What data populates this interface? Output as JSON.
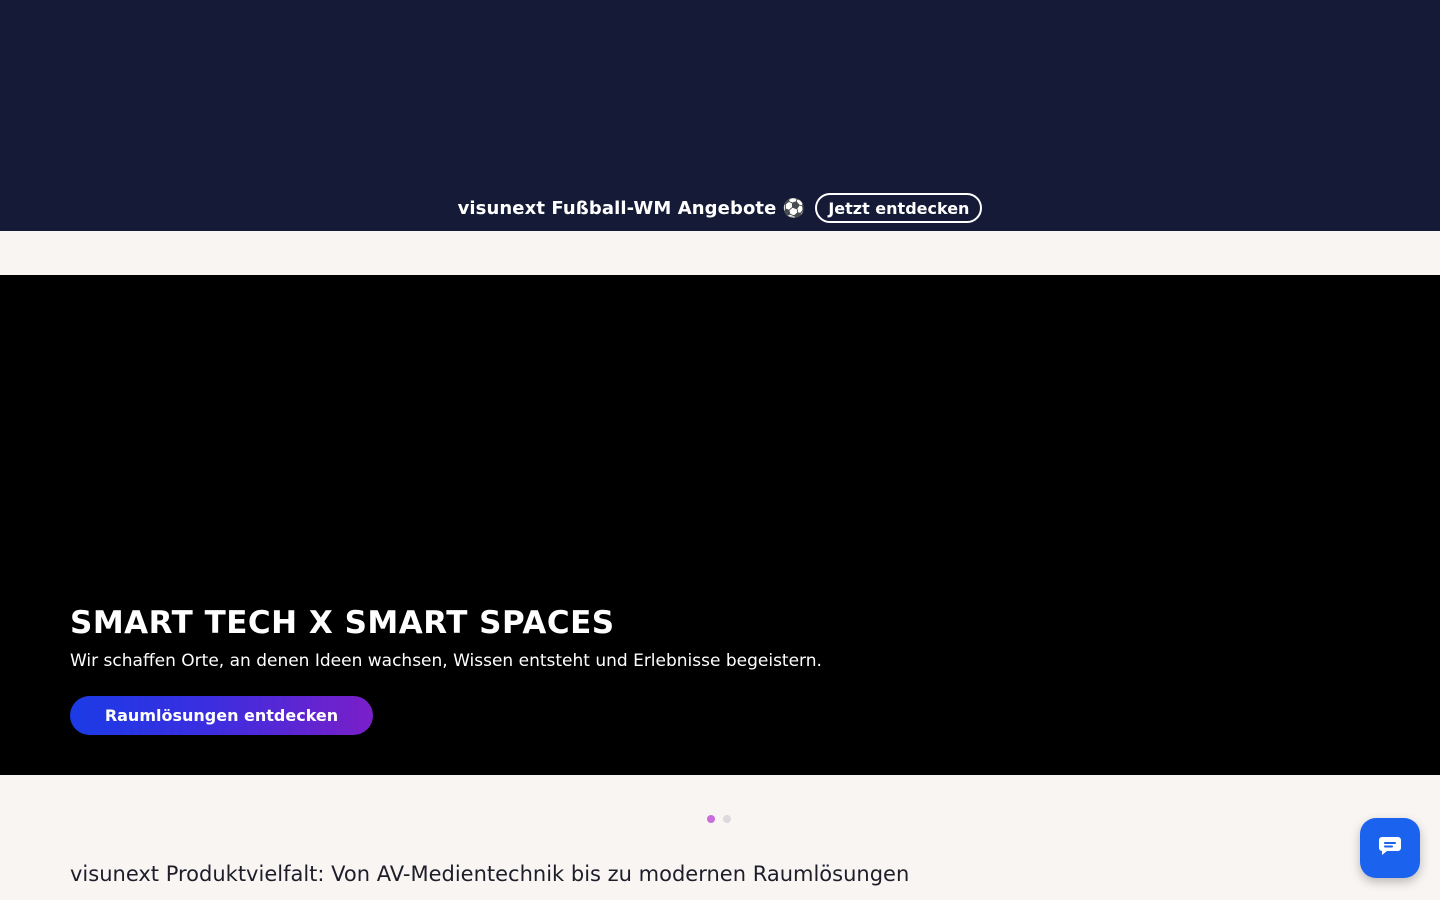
{
  "promo": {
    "text": "visunext Fußball-WM Angebote ⚽",
    "button_label": "Jetzt entdecken"
  },
  "hero": {
    "title": "SMART TECH X SMART SPACES",
    "subtitle": "Wir schaffen Orte, an denen Ideen wachsen, Wissen entsteht und Erlebnisse begeistern.",
    "cta_label": "Raumlösungen entdecken"
  },
  "slider": {
    "slide_count": 2,
    "active_slide": 1
  },
  "section": {
    "heading": "visunext Produktvielfalt: Von AV-Medientechnik bis zu modernen Raumlösungen"
  },
  "chat": {
    "icon": "chat-bubble-icon"
  },
  "colors": {
    "banner_bg": "#151b37",
    "page_bg": "#f8f5f3",
    "hero_bg": "#000000",
    "cta_gradient_start": "#1b3be6",
    "cta_gradient_end": "#7a1fc8",
    "dot_active": "#c86ddb",
    "chat_accent": "#1b63ee"
  }
}
